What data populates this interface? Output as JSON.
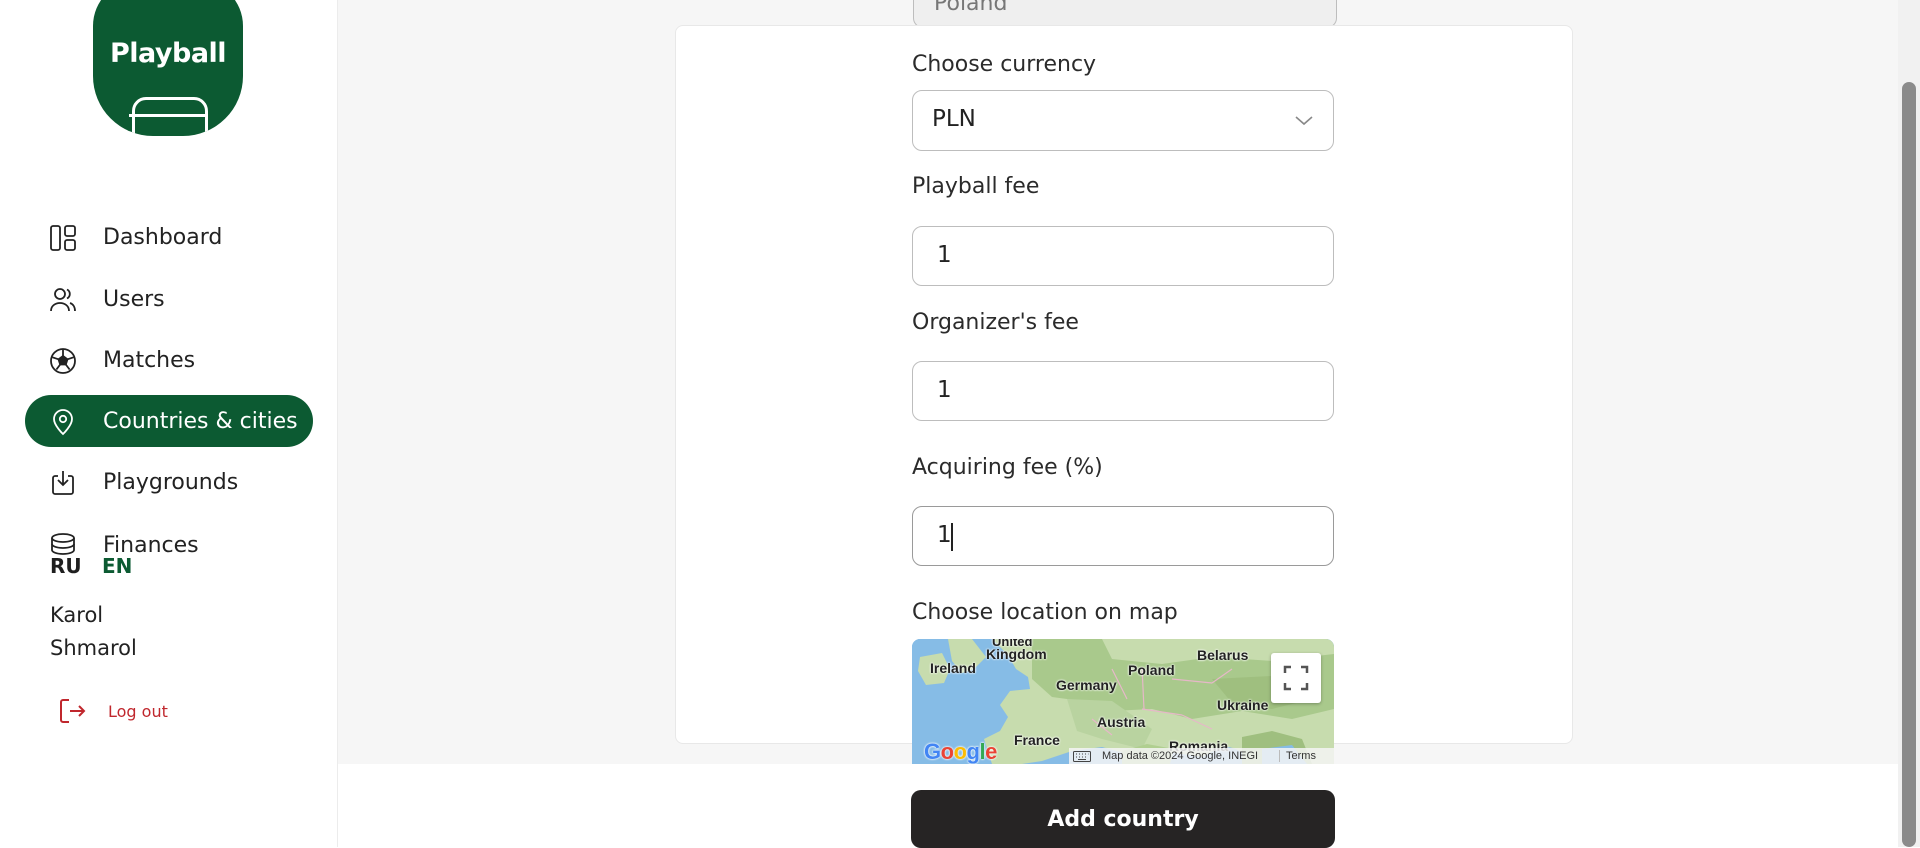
{
  "brand": {
    "logo_text": "Playball"
  },
  "sidebar": {
    "items": [
      {
        "label": "Dashboard",
        "icon": "dashboard-icon"
      },
      {
        "label": "Users",
        "icon": "users-icon"
      },
      {
        "label": "Matches",
        "icon": "soccer-ball-icon"
      },
      {
        "label": "Countries & cities",
        "icon": "location-pin-icon",
        "active": true
      },
      {
        "label": "Playgrounds",
        "icon": "download-icon"
      },
      {
        "label": "Finances",
        "icon": "coins-icon"
      }
    ],
    "languages": [
      {
        "code": "RU",
        "active": false
      },
      {
        "code": "EN",
        "active": true
      }
    ],
    "user": {
      "first_name": "Karol",
      "last_name": "Shmarol"
    },
    "logout_label": "Log out"
  },
  "form": {
    "country_value": "Poland",
    "currency": {
      "label": "Choose currency",
      "value": "PLN"
    },
    "playball_fee": {
      "label": "Playball fee",
      "value": "1"
    },
    "organizer_fee": {
      "label": "Organizer's fee",
      "value": "1"
    },
    "acquiring_fee": {
      "label": "Acquiring fee (%)",
      "value": "1"
    },
    "map": {
      "label": "Choose location on map",
      "places": [
        "United Kingdom",
        "Ireland",
        "Germany",
        "Poland",
        "Belarus",
        "Ukraine",
        "Austria",
        "France",
        "Romania"
      ],
      "provider": "Google",
      "attribution": "Map data ©2024 Google, INEGI",
      "terms": "Terms"
    },
    "submit_label": "Add country"
  },
  "colors": {
    "brand_green": "#0c5a32",
    "button_dark": "#262424",
    "logout_red": "#c0272d"
  }
}
